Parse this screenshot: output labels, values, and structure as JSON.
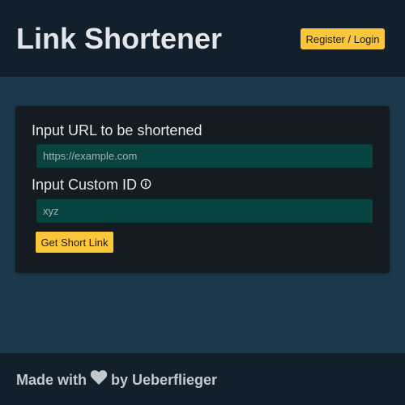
{
  "header": {
    "title": "Link Shortener",
    "login_label": "Register / Login"
  },
  "form": {
    "url_label": "Input URL to be shortened",
    "url_placeholder": "https://example.com",
    "url_value": "",
    "custom_id_label": "Input Custom ID",
    "custom_id_info_icon": "info-icon",
    "custom_id_placeholder": "xyz",
    "custom_id_value": "",
    "submit_label": "Get Short Link"
  },
  "footer": {
    "made_with": "Made with",
    "heart_icon": "heart-icon",
    "by_author": "by Ueberflieger"
  },
  "colors": {
    "page_background": "#1b3a4c",
    "bar_background": "#12202b",
    "card_background": "#141c22",
    "input_background": "#08443f",
    "accent": "#fcc63b"
  }
}
